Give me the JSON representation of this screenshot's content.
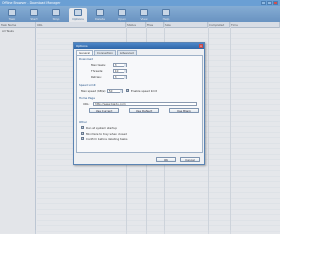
{
  "window": {
    "title": "Offline Browser - Download Manager",
    "controls": [
      "minimize",
      "maximize",
      "close"
    ]
  },
  "toolbar": {
    "items": [
      {
        "label": "Task",
        "icon": "task-icon"
      },
      {
        "label": "Start",
        "icon": "start-icon"
      },
      {
        "label": "Stop",
        "icon": "stop-icon"
      },
      {
        "label": "Options",
        "icon": "options-icon",
        "selected": true
      },
      {
        "label": "Delete",
        "icon": "delete-icon"
      },
      {
        "label": "Open",
        "icon": "open-icon"
      },
      {
        "label": "View",
        "icon": "view-icon"
      },
      {
        "label": "Help",
        "icon": "help-icon"
      }
    ]
  },
  "list": {
    "columns": [
      "Task Name",
      "URL",
      "Status",
      "Files",
      "Size",
      "Completed",
      "Time"
    ]
  },
  "sidebar": {
    "items": [
      "All Tasks"
    ]
  },
  "dialog": {
    "title": "Options",
    "close": "×",
    "tabs": [
      "General",
      "Connection",
      "Advanced"
    ],
    "download_group": "Download",
    "fields": {
      "max_tasks_label": "Max tasks:",
      "max_tasks_value": "3",
      "threads_label": "Threads:",
      "threads_value": "10",
      "retries_label": "Retries:",
      "retries_value": "3"
    },
    "speed_group": "Speed Limit",
    "speed": {
      "label": "Max speed (KB/s):",
      "value": "50",
      "checkbox_label": "Enable speed limit",
      "checked": true
    },
    "homepage_group": "Home Page",
    "homepage": {
      "label": "URL:",
      "value": "http://www.baidu.com"
    },
    "homepage_buttons": [
      "Use Current",
      "Use Default",
      "Use Blank"
    ],
    "other_group": "Other",
    "options": [
      {
        "label": "Run at system startup",
        "checked": true
      },
      {
        "label": "Minimize to tray when closed",
        "checked": true
      },
      {
        "label": "Confirm before deleting tasks",
        "checked": true
      }
    ],
    "ok_label": "OK",
    "cancel_label": "Cancel"
  }
}
